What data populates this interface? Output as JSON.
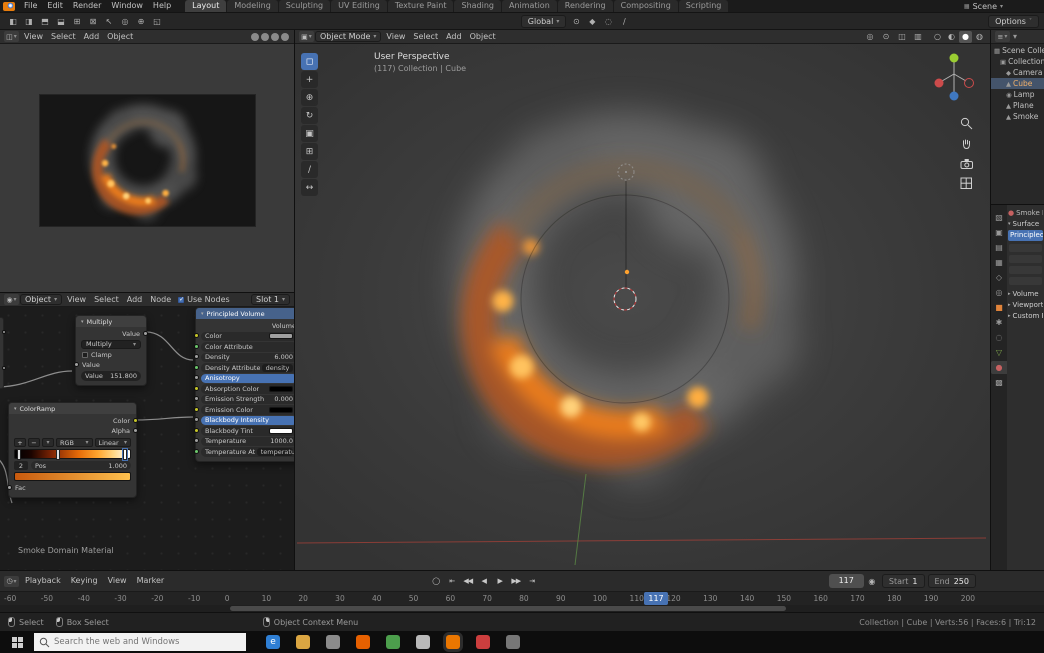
{
  "topbar": {
    "menus": [
      "File",
      "Edit",
      "Render",
      "Window",
      "Help"
    ],
    "tabs": [
      {
        "label": "Layout",
        "cls": "active"
      },
      {
        "label": "Modeling"
      },
      {
        "label": "Sculpting"
      },
      {
        "label": "UV Editing"
      },
      {
        "label": "Texture Paint"
      },
      {
        "label": "Shading"
      },
      {
        "label": "Animation"
      },
      {
        "label": "Rendering"
      },
      {
        "label": "Compositing"
      },
      {
        "label": "Scripting"
      }
    ],
    "scene_label": "Scene"
  },
  "toolrow": {
    "left_icons": [
      {
        "g": "◧"
      },
      {
        "g": "◨"
      },
      {
        "g": "⬒"
      },
      {
        "g": "⬓"
      },
      {
        "g": "⊞"
      },
      {
        "g": "⊠"
      },
      {
        "g": "↖"
      },
      {
        "g": "◎"
      },
      {
        "g": "⊕"
      },
      {
        "g": "◱"
      }
    ],
    "orientation": "Global",
    "mid_icons": [
      {
        "g": "⊙"
      },
      {
        "g": "◆"
      },
      {
        "g": "◌"
      },
      {
        "g": "∕"
      }
    ],
    "options_label": "Options"
  },
  "preview_editor": {
    "menus": [
      "View",
      "Select",
      "Add",
      "Object"
    ],
    "shading_balls": 4
  },
  "viewport": {
    "mode": "Object Mode",
    "menus": [
      "View",
      "Select",
      "Add",
      "Object"
    ],
    "overlay_line1": "User Perspective",
    "overlay_line2": "(117) Collection | Cube",
    "tools": [
      {
        "g": "◻",
        "cls": "active"
      },
      {
        "g": "+"
      },
      {
        "g": "⊕"
      },
      {
        "g": "↻"
      },
      {
        "g": "▣"
      },
      {
        "g": "⊞"
      },
      {
        "g": "∕"
      },
      {
        "g": "↔"
      }
    ],
    "header_icons": [
      {
        "g": "◎"
      },
      {
        "g": "⊙"
      },
      {
        "g": "◫"
      },
      {
        "g": "▥"
      }
    ],
    "shading_modes": [
      {
        "g": "○"
      },
      {
        "g": "◐"
      },
      {
        "g": "●",
        "cls": "active"
      },
      {
        "g": "◍"
      }
    ]
  },
  "node_editor": {
    "shader_type": "Object",
    "menus": [
      "View",
      "Select",
      "Add",
      "Node"
    ],
    "use_nodes_label": "Use Nodes",
    "slot_label": "Slot 1",
    "material_label": "Smoke Domain Material",
    "multiply": {
      "title": "Multiply",
      "output": "Value",
      "operation": "Multiply",
      "clamp_label": "Clamp",
      "input_label": "Value",
      "value_label": "Value",
      "value": "151.800"
    },
    "principled": {
      "title": "Principled Volume",
      "output": "Volume",
      "rows": [
        {
          "label": "Color",
          "cls": "swatch",
          "swatch": "#9f9f9f",
          "sc": "#c7c729"
        },
        {
          "label": "Color Attribute",
          "value": "",
          "cls": "field",
          "sc": "#6cc76c"
        },
        {
          "label": "Density",
          "value": "6.000",
          "sc": "#a1a1a1"
        },
        {
          "label": "Density Attribute",
          "value": "density",
          "cls": "field",
          "sc": "#6cc76c"
        },
        {
          "label": "Anisotropy",
          "value": "",
          "cls": "blue",
          "sc": "#a1a1a1"
        },
        {
          "label": "Absorption Color",
          "cls": "swatch",
          "swatch": "#000000",
          "sc": "#c7c729"
        },
        {
          "label": "Emission Strength",
          "value": "0.000",
          "sc": "#a1a1a1"
        },
        {
          "label": "Emission Color",
          "cls": "swatch",
          "swatch": "#000000",
          "sc": "#c7c729"
        },
        {
          "label": "Blackbody Intensity",
          "value": "",
          "cls": "blue",
          "sc": "#a1a1a1"
        },
        {
          "label": "Blackbody Tint",
          "cls": "swatch",
          "swatch": "#ffffff",
          "sc": "#c7c729"
        },
        {
          "label": "Temperature",
          "value": "1000.0",
          "sc": "#a1a1a1"
        },
        {
          "label": "Temperature Attribute",
          "value": "temperature",
          "cls": "field",
          "sc": "#6cc76c"
        }
      ]
    },
    "colorramp": {
      "title": "ColorRamp",
      "out_color": "Color",
      "out_alpha": "Alpha",
      "btn_add": "+",
      "btn_del": "−",
      "color_mode": "RGB",
      "interpolation": "Linear",
      "index": "2",
      "pos_label": "Pos",
      "pos_value": "1.000",
      "input_label": "Fac"
    }
  },
  "outliner": {
    "items": [
      {
        "g": "▦",
        "label": "Scene Collection"
      },
      {
        "g": "▣",
        "label": "Collection",
        "cls": "ind1"
      },
      {
        "g": "◆",
        "label": "Camera",
        "cls": "ind2"
      },
      {
        "g": "▲",
        "label": "Cube",
        "cls": "ind2 sel"
      },
      {
        "g": "◉",
        "label": "Lamp",
        "cls": "ind2"
      },
      {
        "g": "▲",
        "label": "Plane",
        "cls": "ind2"
      },
      {
        "g": "▲",
        "label": "Smoke",
        "cls": "ind2"
      }
    ]
  },
  "properties": {
    "tabs": [
      {
        "g": "▧"
      },
      {
        "g": "▣"
      },
      {
        "g": "▤"
      },
      {
        "g": "▦"
      },
      {
        "g": "◇"
      },
      {
        "g": "◎"
      },
      {
        "g": "■",
        "c": "#e0833a"
      },
      {
        "g": "✱"
      },
      {
        "g": "◌"
      },
      {
        "g": "▽",
        "c": "#7ea44c"
      },
      {
        "g": "●",
        "c": "#c66161",
        "cls": "active"
      },
      {
        "g": "▩"
      }
    ],
    "datablock": "Smoke Domain Material",
    "surface_panel": "Surface",
    "surface_button": "Principled Volume",
    "panels": [
      {
        "label": "Volume"
      },
      {
        "label": "Viewport Display"
      },
      {
        "label": "Custom Properties"
      }
    ]
  },
  "timeline": {
    "menus": [
      "Playback",
      "Keying",
      "View",
      "Marker"
    ],
    "buttons": [
      {
        "g": "◯"
      },
      {
        "g": "⇤"
      },
      {
        "g": "◀◀"
      },
      {
        "g": "◀"
      },
      {
        "g": "▶"
      },
      {
        "g": "▶▶"
      },
      {
        "g": "⇥"
      }
    ],
    "current_frame": "117",
    "start_label": "Start",
    "start_value": "1",
    "end_label": "End",
    "end_value": "250",
    "ticks": [
      "-60",
      "-50",
      "-40",
      "-30",
      "-20",
      "-10",
      "0",
      "10",
      "20",
      "30",
      "40",
      "50",
      "60",
      "70",
      "80",
      "90",
      "100",
      "110",
      "120",
      "130",
      "140",
      "150",
      "160",
      "170",
      "180",
      "190",
      "200"
    ]
  },
  "statusbar": {
    "select_label": "Select",
    "box_select_label": "Box Select",
    "context_label": "Object Context Menu",
    "stats": "Collection | Cube | Verts:56 | Faces:6 | Tri:12"
  },
  "taskbar": {
    "search_placeholder": "Search the web and Windows",
    "icons": [
      {
        "c": "#2f7fd4",
        "g": "e"
      },
      {
        "c": "#dba642",
        "g": ""
      },
      {
        "c": "#8b8b8b",
        "g": ""
      },
      {
        "c": "#e66000",
        "g": ""
      },
      {
        "c": "#4c9e4c",
        "g": ""
      },
      {
        "c": "#b9b9b9",
        "g": ""
      },
      {
        "c": "#ea7600",
        "g": "",
        "cls": "active"
      },
      {
        "c": "#cc3e3e",
        "g": ""
      },
      {
        "c": "#777777",
        "g": ""
      }
    ]
  },
  "colors": {
    "accent_blue": "#4772b3",
    "blender_orange": "#e87d0d",
    "selected_text": "#f0b06a"
  }
}
